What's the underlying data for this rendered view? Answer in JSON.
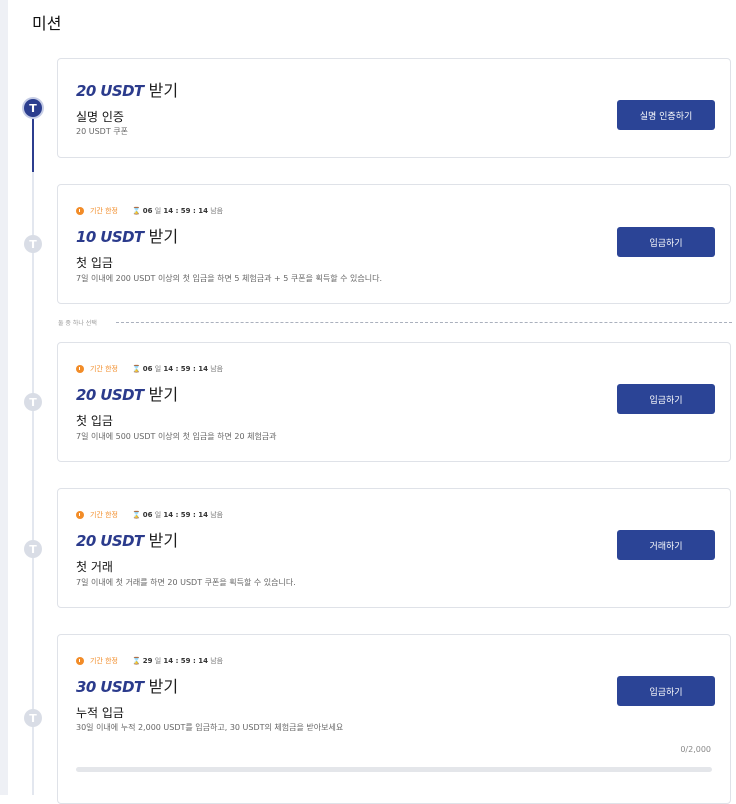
{
  "page": {
    "title": "미션"
  },
  "icons": {
    "timeline_node": "T"
  },
  "colors": {
    "accent": "#2b4496",
    "timer_orange": "#f28c28"
  },
  "divider": {
    "label": "둘 중 하나 선택"
  },
  "missions": [
    {
      "reward_amount": "20 USDT",
      "reward_suffix": " 받기",
      "title": "실명 인증",
      "description": "20 USDT 쿠폰",
      "button": "실명 인증하기"
    },
    {
      "limited": "기간 한정",
      "timer_days": "06",
      "timer_days_unit": "일",
      "timer_time": "14 : 59 : 14",
      "timer_suffix": "남음",
      "reward_amount": "10 USDT",
      "reward_suffix": " 받기",
      "title": "첫 입금",
      "description": "7일 이내에 200 USDT 이상의 첫 입금을 하면 5 체험금과 + 5 쿠폰을 획득할 수 있습니다.",
      "button": "입금하기"
    },
    {
      "limited": "기간 한정",
      "timer_days": "06",
      "timer_days_unit": "일",
      "timer_time": "14 : 59 : 14",
      "timer_suffix": "남음",
      "reward_amount": "20 USDT",
      "reward_suffix": " 받기",
      "title": "첫 입금",
      "description": "7일 이내에 500 USDT 이상의 첫 입금을 하면 20 체험금과",
      "button": "입금하기"
    },
    {
      "limited": "기간 한정",
      "timer_days": "06",
      "timer_days_unit": "일",
      "timer_time": "14 : 59 : 14",
      "timer_suffix": "남음",
      "reward_amount": "20 USDT",
      "reward_suffix": " 받기",
      "title": "첫 거래",
      "description": "7일 이내에 첫 거래를 하면 20 USDT 쿠폰을 획득할 수 있습니다.",
      "button": "거래하기"
    },
    {
      "limited": "기간 한정",
      "timer_days": "29",
      "timer_days_unit": "일",
      "timer_time": "14 : 59 : 14",
      "timer_suffix": "남음",
      "reward_amount": "30 USDT",
      "reward_suffix": " 받기",
      "title": "누적 입금",
      "description": "30일 이내에 누적 2,000 USDT를 입금하고, 30 USDT의 체험금을 받아보세요",
      "button": "입금하기",
      "progress_text": "0/2,000",
      "progress_fraction": 0
    }
  ]
}
